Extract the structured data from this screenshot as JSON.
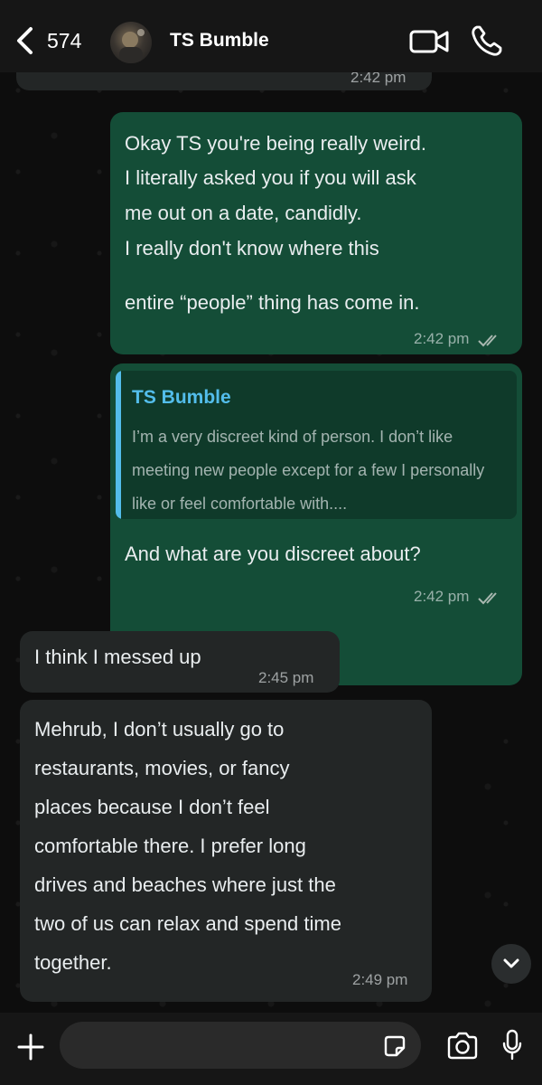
{
  "header": {
    "back_count": "574",
    "contact_name": "TS Bumble"
  },
  "messages": {
    "prev": {
      "time": "2:42 pm"
    },
    "m1": {
      "lines": [
        "Okay TS you're being really weird.",
        "I literally asked you if you will ask",
        "me out on a date, candidly.",
        "I really don't know where this",
        "entire “people” thing has come in."
      ],
      "time": "2:42 pm"
    },
    "m2": {
      "quote_author": "TS Bumble",
      "quote_text": "I’m a very discreet kind of person. I don’t like meeting new people except for a few I personally like or feel comfortable with....",
      "text": "And what are you discreet about?",
      "time": "2:42 pm"
    },
    "m3": {
      "text": "I think I messed up",
      "time": "2:45 pm"
    },
    "m4": {
      "lines": [
        "Mehrub, I don’t usually go to",
        "restaurants, movies, or fancy",
        "places because I don’t feel",
        "comfortable there. I prefer long",
        "drives and beaches where just the",
        "two of us can relax and spend time",
        "together."
      ],
      "time": "2:49 pm"
    }
  },
  "colors": {
    "outgoing_bubble": "#144d37",
    "incoming_bubble": "#232626",
    "quote_accent": "#53bdeb"
  },
  "footer": {
    "input_placeholder": ""
  }
}
